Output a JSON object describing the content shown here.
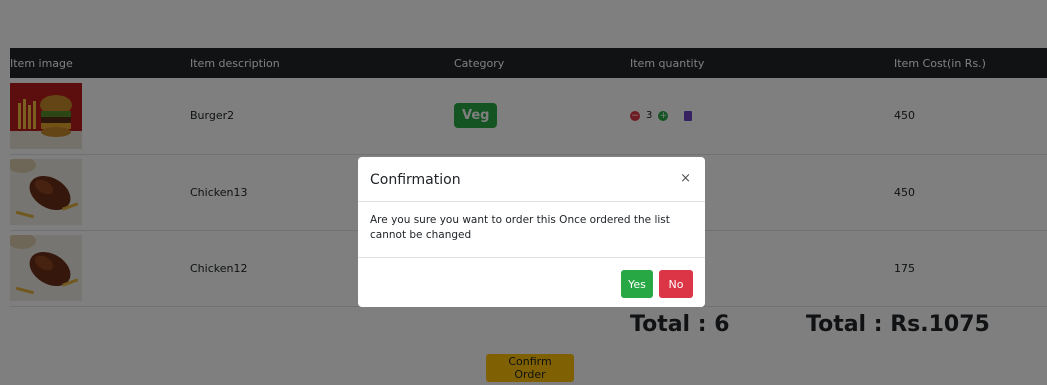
{
  "table": {
    "headers": [
      "Item image",
      "Item description",
      "Category",
      "Item quantity",
      "Item Cost(in Rs.)"
    ],
    "rows": [
      {
        "image_icon": "burger-image",
        "description": "Burger2",
        "category": "Veg",
        "quantity": "3",
        "cost": "450"
      },
      {
        "image_icon": "chicken-image",
        "description": "Chicken13",
        "category": "",
        "quantity": "",
        "cost": "450"
      },
      {
        "image_icon": "chicken-image",
        "description": "Chicken12",
        "category": "",
        "quantity": "",
        "cost": "175"
      }
    ]
  },
  "totals": {
    "count_label": "Total : 6",
    "amount_label": "Total : Rs.1075"
  },
  "confirm_button": "Confirm Order",
  "modal": {
    "title": "Confirmation",
    "close": "×",
    "body": "Are you sure you want to order this Once ordered the list cannot be changed",
    "yes": "Yes",
    "no": "No"
  },
  "colors": {
    "header_bg": "#212529",
    "veg_badge": "#28a745",
    "confirm": "#ffc107",
    "yes": "#28a745",
    "no": "#dc3545",
    "trash": "#6f42c1"
  }
}
